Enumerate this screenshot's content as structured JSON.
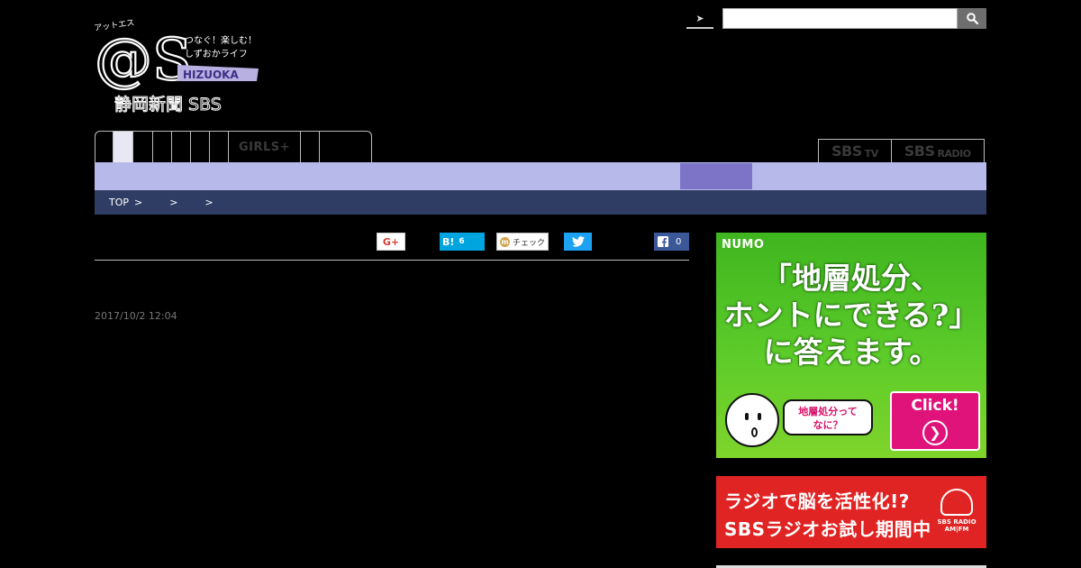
{
  "header": {
    "logo": {
      "at_s": "@S",
      "katakana": "アットエス",
      "tagline_line1": "つなぐ！楽しむ！",
      "tagline_line2": "しずおかライフ",
      "hizuoka": "HIZUOKA",
      "publisher": "静岡新聞 SBS"
    },
    "search": {
      "toggle_icon": "chevron-right-icon",
      "placeholder": "",
      "button_icon": "search-icon"
    }
  },
  "tabs": [
    {
      "label": ""
    },
    {
      "label": ""
    },
    {
      "label": ""
    },
    {
      "label": ""
    },
    {
      "label": ""
    },
    {
      "label": ""
    },
    {
      "label": ""
    },
    {
      "label": "GIRLS+"
    },
    {
      "label": ""
    },
    {
      "label": ""
    }
  ],
  "sbs_links": [
    {
      "main": "SBS",
      "suffix": "TV"
    },
    {
      "main": "SBS",
      "suffix": "RADIO"
    }
  ],
  "breadcrumb": {
    "top": "TOP",
    "separator": ">"
  },
  "share": {
    "gplus_label": "G+",
    "hatena_label": "B!",
    "hatena_count": "6",
    "mixi_label": "チェック",
    "facebook_count": "0"
  },
  "article": {
    "date": "2017/10/2 12:04"
  },
  "ads": {
    "numo": {
      "brand": "NUMO",
      "headline_line1": "「地層処分、",
      "headline_line2": "ホントにできる?」",
      "headline_line3": "に答えます。",
      "bubble_line1": "地層処分って",
      "bubble_line2": "なに？",
      "cta": "Click!"
    },
    "sbs_radio": {
      "line1": "ラジオで脳を活性化!?",
      "line2": "SBSラジオお試し期間中",
      "logo_line1": "SBS RADIO",
      "logo_line2": "AM|FM"
    }
  },
  "colors": {
    "navbar": "#b8b9eb",
    "navbar_active": "#7d74c8",
    "breadcrumb_bg": "#2f3c63",
    "numo_green": "#4cbf22",
    "radio_red": "#e02424"
  }
}
